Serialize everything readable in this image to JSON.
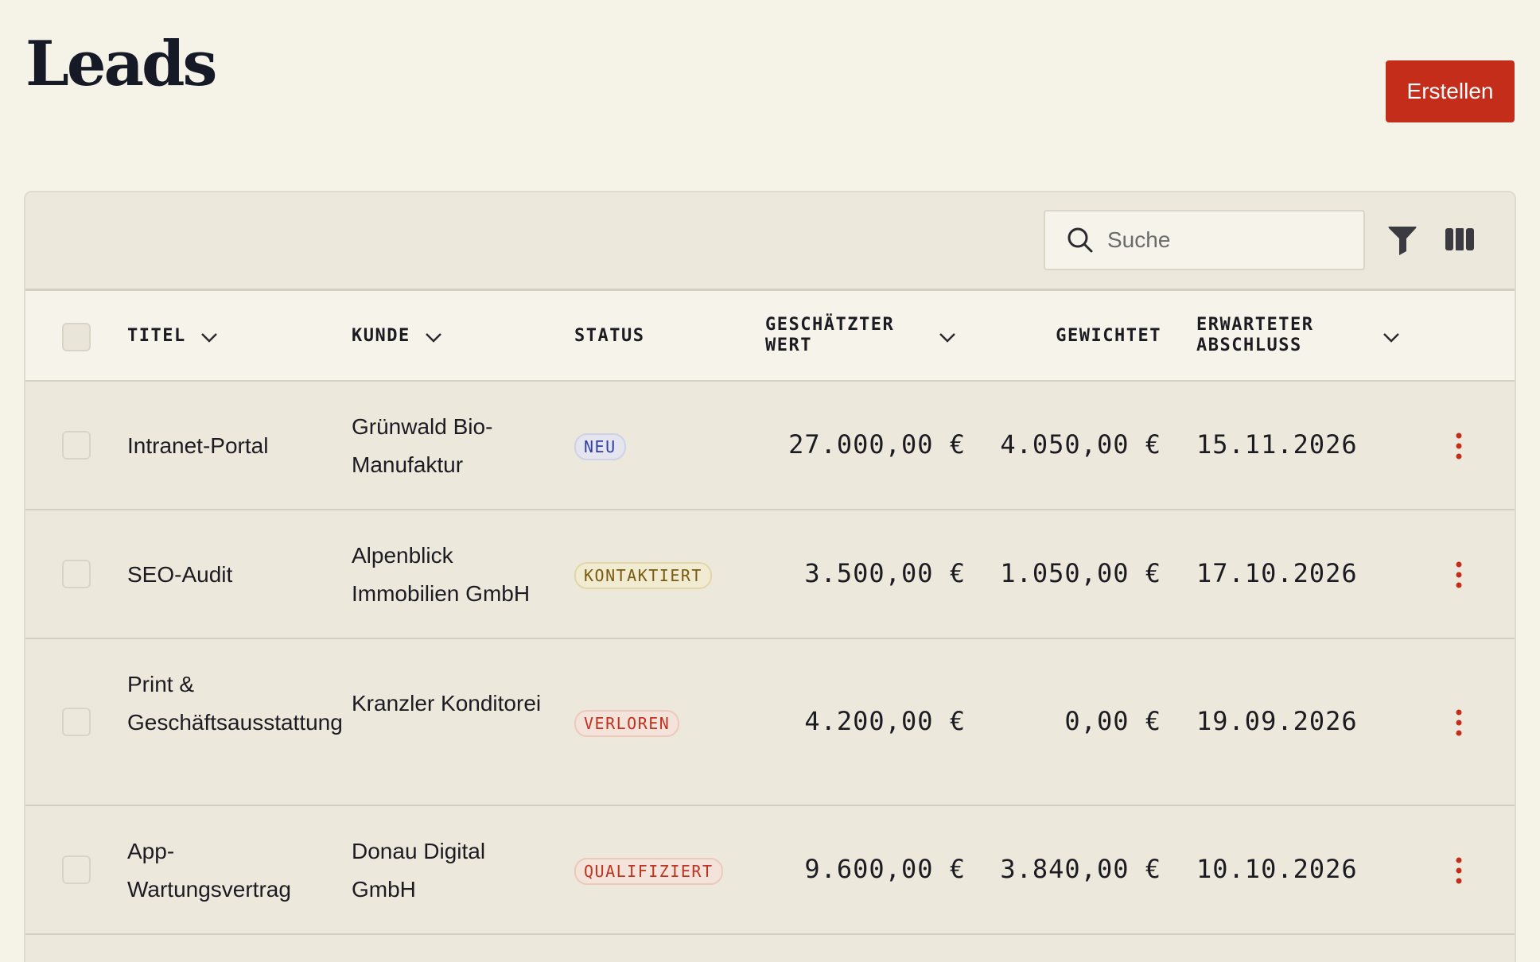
{
  "header": {
    "title": "Leads",
    "create_label": "Erstellen"
  },
  "toolbar": {
    "search_placeholder": "Suche",
    "search_value": "",
    "icons": [
      "search-icon",
      "filter-icon",
      "columns-icon"
    ]
  },
  "table": {
    "columns": [
      {
        "label": "TITEL",
        "sortable": true
      },
      {
        "label": "KUNDE",
        "sortable": true
      },
      {
        "label": "STATUS",
        "sortable": false
      },
      {
        "label": "GESCHÄTZTER WERT",
        "sortable": true
      },
      {
        "label": "GEWICHTET",
        "sortable": false
      },
      {
        "label": "ERWARTETER ABSCHLUSS",
        "sortable": true
      }
    ],
    "rows": [
      {
        "title": "Intranet-Portal",
        "client": "Grünwald Bio-Manufaktur",
        "status": "NEU",
        "value": "27.000,00 €",
        "weighted": "4.050,00 €",
        "close_date": "15.11.2026"
      },
      {
        "title": "SEO-Audit",
        "client": "Alpenblick Immobilien GmbH",
        "status": "KONTAKTIERT",
        "value": "3.500,00 €",
        "weighted": "1.050,00 €",
        "close_date": "17.10.2026"
      },
      {
        "title": "Print & Geschäftsausstattung",
        "client": "Kranzler Konditorei",
        "status": "VERLOREN",
        "value": "4.200,00 €",
        "weighted": "0,00 €",
        "close_date": "19.09.2026"
      },
      {
        "title": "App-Wartungsvertrag",
        "client": "Donau Digital GmbH",
        "status": "QUALIFIZIERT",
        "value": "9.600,00 €",
        "weighted": "3.840,00 €",
        "close_date": "10.10.2026"
      }
    ]
  },
  "status_colors": {
    "NEU": {
      "text": "#2f3ea0",
      "bg": "#e4e5ee",
      "border": "#cfd2e6"
    },
    "KONTAKTIERT": {
      "text": "#7a5a10",
      "bg": "#f1ebd2",
      "border": "#e2d6a8"
    },
    "VERLOREN": {
      "text": "#c0321d",
      "bg": "#f4e3db",
      "border": "#edc9bb"
    },
    "QUALIFIZIERT": {
      "text": "#c0321d",
      "bg": "#f4e3db",
      "border": "#edc9bb"
    }
  },
  "colors": {
    "accent": "#c42d1a",
    "background": "#f5f3e8",
    "table_background": "#ece8dc"
  }
}
